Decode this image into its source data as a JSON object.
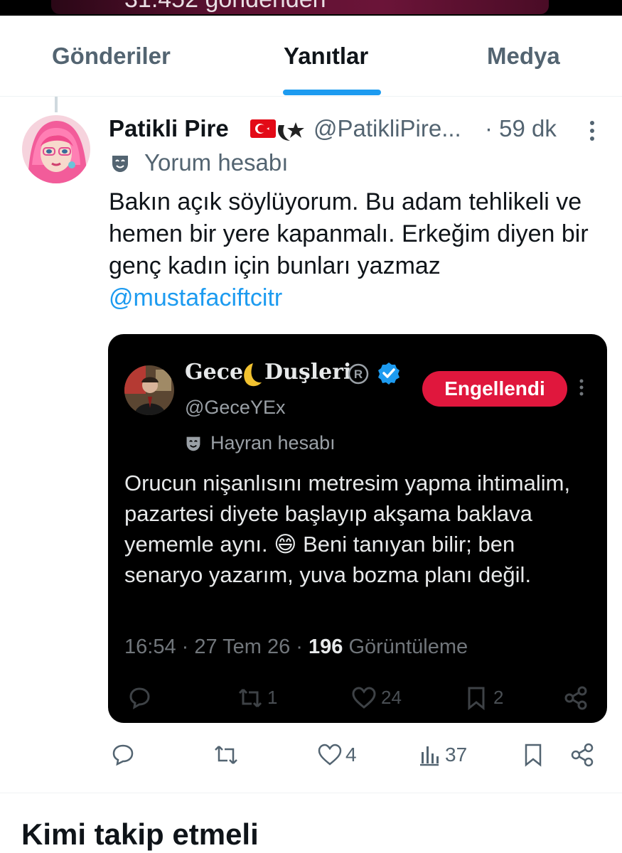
{
  "top_banner": {
    "partial_text": "31.452 gönderiden"
  },
  "tabs": [
    {
      "label": "Gönderiler",
      "active": false
    },
    {
      "label": "Yanıtlar",
      "active": true
    },
    {
      "label": "Medya",
      "active": false
    }
  ],
  "tweet": {
    "display_name": "Patikli Pire",
    "handle": "@PatikliPire...",
    "time": "· 59 dk",
    "badge": "Yorum hesabı",
    "text": "Bakın açık söylüyorum. Bu adam tehlikeli ve hemen bir yere kapanmalı. Erkeğim diyen bir genç kadın için bunları yazmaz",
    "mention": "@mustafaciftcitr",
    "stats": {
      "replies": "",
      "retweets": "",
      "likes": "4",
      "views": "37"
    }
  },
  "quoted": {
    "name_part1": "Gece",
    "name_part2": "Duşleri",
    "handle": "@GeceYEx",
    "blocked_label": "Engellendi",
    "badge": "Hayran hesabı",
    "text": "Orucun nişanlısını metresim yapma ihtimalim, pazartesi diyete başlayıp akşama baklava yememle aynı. 😄 Beni tanıyan bilir; ben senaryo yazarım, yuva bozma planı değil.",
    "time": "16:54 · 27 Tem 26 · ",
    "views_count": "196",
    "views_label": " Görüntüleme",
    "stats": {
      "replies": "",
      "retweets": "1",
      "likes": "24",
      "bookmarks": "2"
    }
  },
  "section_title": "Kimi takip etmeli",
  "colors": {
    "accent": "#1d9bf0",
    "blocked": "#e0173d",
    "secondary_text": "#536471"
  }
}
